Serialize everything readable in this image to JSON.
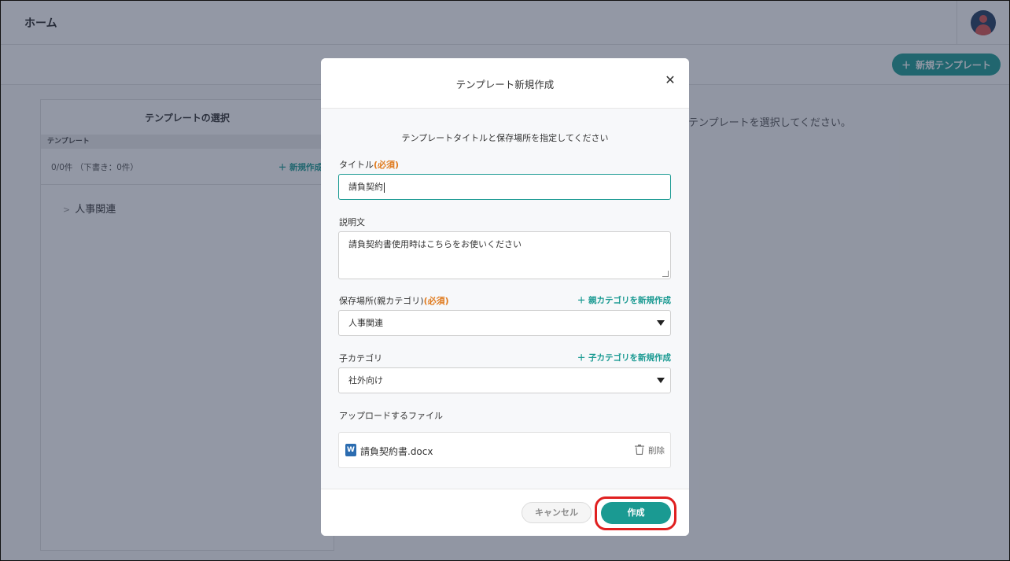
{
  "header": {
    "title": "ホーム"
  },
  "toolbar": {
    "new_template_label": "新規テンプレート"
  },
  "sidebar": {
    "title": "テンプレートの選択",
    "column_header": "テンプレート",
    "count": "0/0件 （下書き：0件）",
    "new_label": "新規作成",
    "tree_items": [
      "人事関連"
    ]
  },
  "main": {
    "hint": "テンプレートを選択してください。"
  },
  "modal": {
    "title": "テンプレート新規作成",
    "instruction": "テンプレートタイトルと保存場所を指定してください",
    "title_label": "タイトル",
    "required_mark": "(必須)",
    "title_value": "請負契約",
    "description_label": "説明文",
    "description_value": "請負契約書使用時はこちらをお使いください",
    "parent_label": "保存場所(親カテゴリ)",
    "parent_add_label": "親カテゴリを新規作成",
    "parent_value": "人事関連",
    "child_label": "子カテゴリ",
    "child_add_label": "子カテゴリを新規作成",
    "child_value": "社外向け",
    "upload_label": "アップロードするファイル",
    "file_name": "請負契約書.docx",
    "delete_label": "削除",
    "cancel_label": "キャンセル",
    "create_label": "作成"
  },
  "colors": {
    "accent": "#1a9a92",
    "required": "#e07b1f",
    "highlight": "#e02020"
  }
}
